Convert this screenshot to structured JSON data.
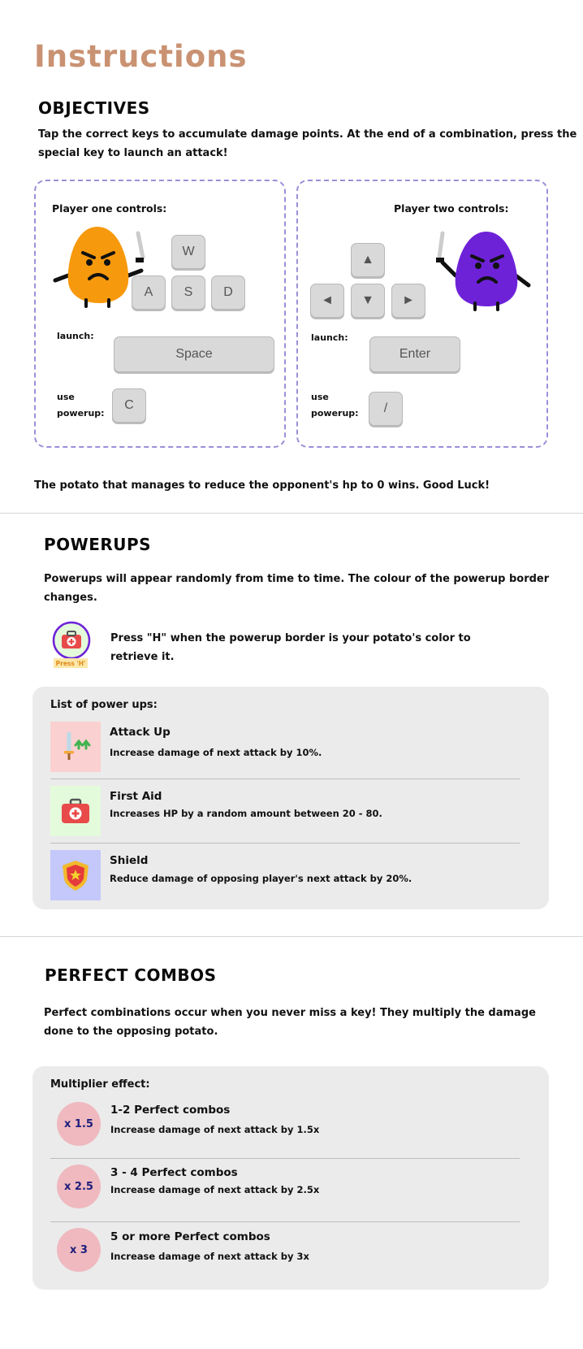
{
  "title": "Instructions",
  "objectives": {
    "heading": "OBJECTIVES",
    "text_line1": "Tap the correct keys to accumulate damage points. At the end of a combination, press the",
    "text_line2": "special key to launch an attack!"
  },
  "player_one": {
    "title": "Player one controls:",
    "keys": {
      "up": "W",
      "left": "A",
      "down": "S",
      "right": "D"
    },
    "launch_label": "launch:",
    "launch_key": "Space",
    "powerup_label_1": "use",
    "powerup_label_2": "powerup:",
    "powerup_key": "C",
    "color": "#f7990c"
  },
  "player_two": {
    "title": "Player two controls:",
    "keys": {
      "up": "▲",
      "left": "◄",
      "down": "▼",
      "right": "►"
    },
    "launch_label": "launch:",
    "launch_key": "Enter",
    "powerup_label_1": "use",
    "powerup_label_2": "powerup:",
    "powerup_key": "/",
    "color": "#6e22d8"
  },
  "win_text": "The potato that manages to reduce the opponent's hp to 0 wins. Good Luck!",
  "powerups": {
    "heading": "POWERUPS",
    "text_line1": "Powerups will appear randomly from time to time. The colour of the powerup border",
    "text_line2": "changes.",
    "press_badge": "Press 'H'",
    "press_text_line1": "Press \"H\" when the powerup border is your potato's color to",
    "press_text_line2": "retrieve it.",
    "list_title": "List of power ups:",
    "items": [
      {
        "name": "Attack Up",
        "desc": "Increase damage of next attack by 10%.",
        "icon": "sword-arrows-icon",
        "bg": "#fbd0d0"
      },
      {
        "name": "First Aid",
        "desc": "Increases HP by a random amount between 20 - 80.",
        "icon": "first-aid-kit-icon",
        "bg": "#e3fbda"
      },
      {
        "name": "Shield",
        "desc": "Reduce damage of opposing player's next attack by 20%.",
        "icon": "shield-icon",
        "bg": "#c4c8fb"
      }
    ]
  },
  "combos": {
    "heading": "PERFECT COMBOS",
    "text_line1": "Perfect combinations occur when you never miss a key! They multiply the damage",
    "text_line2": "done to the opposing potato.",
    "list_title": "Multiplier effect:",
    "items": [
      {
        "mult": "x 1.5",
        "name": "1-2 Perfect combos",
        "desc": "Increase damage of next attack by 1.5x"
      },
      {
        "mult": "x 2.5",
        "name": "3 - 4 Perfect combos",
        "desc": "Increase damage of next attack by 2.5x"
      },
      {
        "mult": "x 3",
        "name": "5 or more Perfect combos",
        "desc": "Increase damage of next attack by 3x"
      }
    ]
  }
}
